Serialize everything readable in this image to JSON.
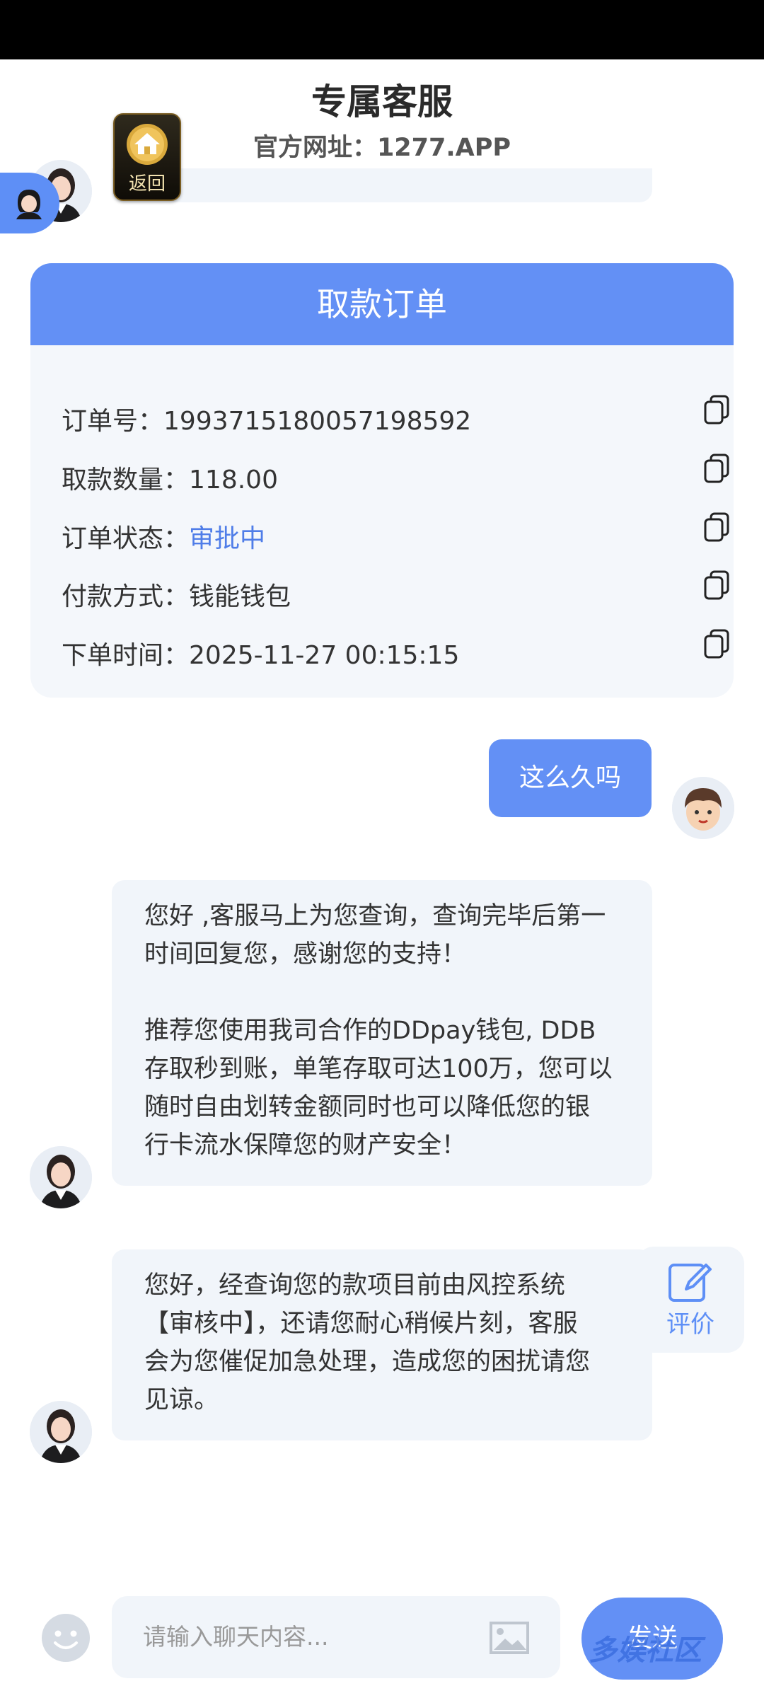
{
  "header": {
    "title": "专属客服",
    "subtitle": "官方网址：1277.APP"
  },
  "back_button": {
    "label": "返回",
    "icon": "home-icon"
  },
  "order": {
    "header": "取款订单",
    "rows": [
      {
        "label": "订单号：",
        "value": "1993715180057198592"
      },
      {
        "label": "取款数量：",
        "value": "118.00"
      },
      {
        "label": "订单状态：",
        "value": "审批中"
      },
      {
        "label": "付款方式：",
        "value": "钱能钱包"
      },
      {
        "label": "下单时间：",
        "value": "2025-11-27 00:15:15"
      }
    ]
  },
  "messages": {
    "user_1": "这么久吗",
    "agent_1": {
      "line1": "您好 ,客服马上为您查询，查询完毕后第一",
      "line2": "时间回复您，感谢您的支持！",
      "line3": "",
      "line4": "推荐您使用我司合作的DDpay钱包, DDB",
      "line5": "存取秒到账，单笔存取可达100万，您可以",
      "line6": "随时自由划转金额同时也可以降低您的银",
      "line7": "行卡流水保障您的财产安全！"
    },
    "agent_2": {
      "line1": "您好，经查询您的款项目前由风控系统",
      "line2": "【审核中】，还请您耐心稍候片刻，客服",
      "line3": "会为您催促加急处理，造成您的困扰请您",
      "line4": "见谅。"
    }
  },
  "rate_button": {
    "label": "评价"
  },
  "input_bar": {
    "placeholder": "请输入聊天内容...",
    "send_label": "发送"
  },
  "watermark": "多娱社区",
  "colors": {
    "accent": "#6390f5",
    "status": "#4f7de8",
    "bubble_bg": "#f1f5fa"
  }
}
